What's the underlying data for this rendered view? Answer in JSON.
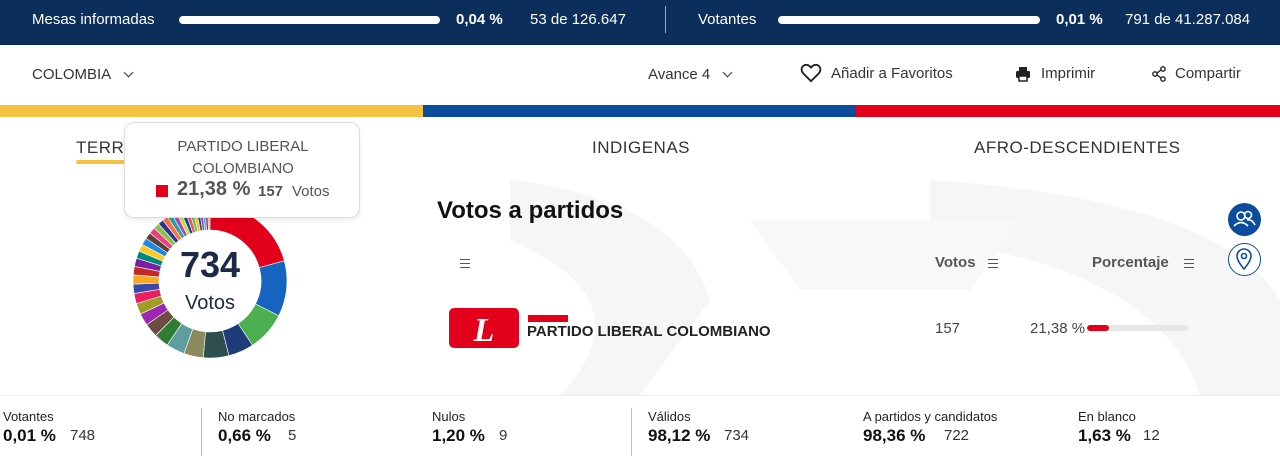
{
  "topbar": {
    "mesas": {
      "label": "Mesas informadas",
      "percent": "0,04 %",
      "count": "53 de 126.647",
      "fraction": 0.0004
    },
    "votantes": {
      "label": "Votantes",
      "percent": "0,01 %",
      "count": "791 de 41.287.084",
      "fraction": 0.0001
    }
  },
  "nav": {
    "region": "COLOMBIA",
    "avance": "Avance 4",
    "favoritos": "Añadir a Favoritos",
    "imprimir": "Imprimir",
    "compartir": "Compartir"
  },
  "colors": {
    "yellow": "#f5c242",
    "blue": "#0c4c9c",
    "red": "#e3001b",
    "navy": "#0b2e5b"
  },
  "tabs": [
    {
      "label": "TERRI"
    },
    {
      "label": "INDIGENAS"
    },
    {
      "label": "AFRO-DESCENDIENTES"
    }
  ],
  "tooltip": {
    "party_line1": "PARTIDO LIBERAL",
    "party_line2": "COLOMBIANO",
    "percent": "21,38 %",
    "votes": "157",
    "votes_label": "Votos"
  },
  "donut": {
    "total": "734",
    "label": "Votos",
    "segments": [
      {
        "value": 21.38,
        "color": "#e3001b"
      },
      {
        "value": 12.0,
        "color": "#1565c0"
      },
      {
        "value": 8.5,
        "color": "#4caf50"
      },
      {
        "value": 5.5,
        "color": "#1f3b7a"
      },
      {
        "value": 5.5,
        "color": "#2f4f4f"
      },
      {
        "value": 4.2,
        "color": "#8a8a5c"
      },
      {
        "value": 4.0,
        "color": "#5f9ea0"
      },
      {
        "value": 3.2,
        "color": "#2e7d32"
      },
      {
        "value": 3.0,
        "color": "#6d4c41"
      },
      {
        "value": 2.6,
        "color": "#9c27b0"
      },
      {
        "value": 2.4,
        "color": "#9e9d24"
      },
      {
        "value": 2.2,
        "color": "#e91e63"
      },
      {
        "value": 2.0,
        "color": "#3949ab"
      },
      {
        "value": 2.0,
        "color": "#f9a825"
      },
      {
        "value": 1.8,
        "color": "#c62828"
      },
      {
        "value": 1.8,
        "color": "#7b1fa2"
      },
      {
        "value": 1.6,
        "color": "#00897b"
      },
      {
        "value": 1.6,
        "color": "#ffca28"
      },
      {
        "value": 1.5,
        "color": "#1e88e5"
      },
      {
        "value": 1.4,
        "color": "#5d4037"
      },
      {
        "value": 1.4,
        "color": "#ec407a"
      },
      {
        "value": 1.3,
        "color": "#8bc34a"
      },
      {
        "value": 1.2,
        "color": "#283593"
      },
      {
        "value": 1.2,
        "color": "#ff7043"
      },
      {
        "value": 1.1,
        "color": "#26a69a"
      },
      {
        "value": 1.0,
        "color": "#ab47bc"
      },
      {
        "value": 1.0,
        "color": "#cddc39"
      },
      {
        "value": 0.9,
        "color": "#0d47a1"
      },
      {
        "value": 0.9,
        "color": "#ef5350"
      },
      {
        "value": 0.8,
        "color": "#66bb6a"
      },
      {
        "value": 0.8,
        "color": "#fbc02d"
      },
      {
        "value": 0.7,
        "color": "#37474f"
      },
      {
        "value": 0.7,
        "color": "#7e57c2"
      },
      {
        "value": 0.6,
        "color": "#29b6f6"
      },
      {
        "value": 0.6,
        "color": "#d81b60"
      },
      {
        "value": 0.5,
        "color": "#9ccc65"
      }
    ]
  },
  "section": {
    "title": "Votos a partidos",
    "col_votos": "Votos",
    "col_pct": "Porcentaje"
  },
  "parties": [
    {
      "name": "PARTIDO LIBERAL COLOMBIANO",
      "votes": "157",
      "percent": "21,38 %",
      "fraction": 0.2138,
      "logo_letter": "L"
    }
  ],
  "bottom": [
    {
      "label": "Votantes",
      "percent": "0,01 %",
      "count": "748"
    },
    {
      "label": "No marcados",
      "percent": "0,66 %",
      "count": "5"
    },
    {
      "label": "Nulos",
      "percent": "1,20 %",
      "count": "9"
    },
    {
      "label": "Válidos",
      "percent": "98,12 %",
      "count": "734"
    },
    {
      "label": "A partidos y candidatos",
      "percent": "98,36 %",
      "count": "722"
    },
    {
      "label": "En blanco",
      "percent": "1,63 %",
      "count": "12"
    }
  ]
}
